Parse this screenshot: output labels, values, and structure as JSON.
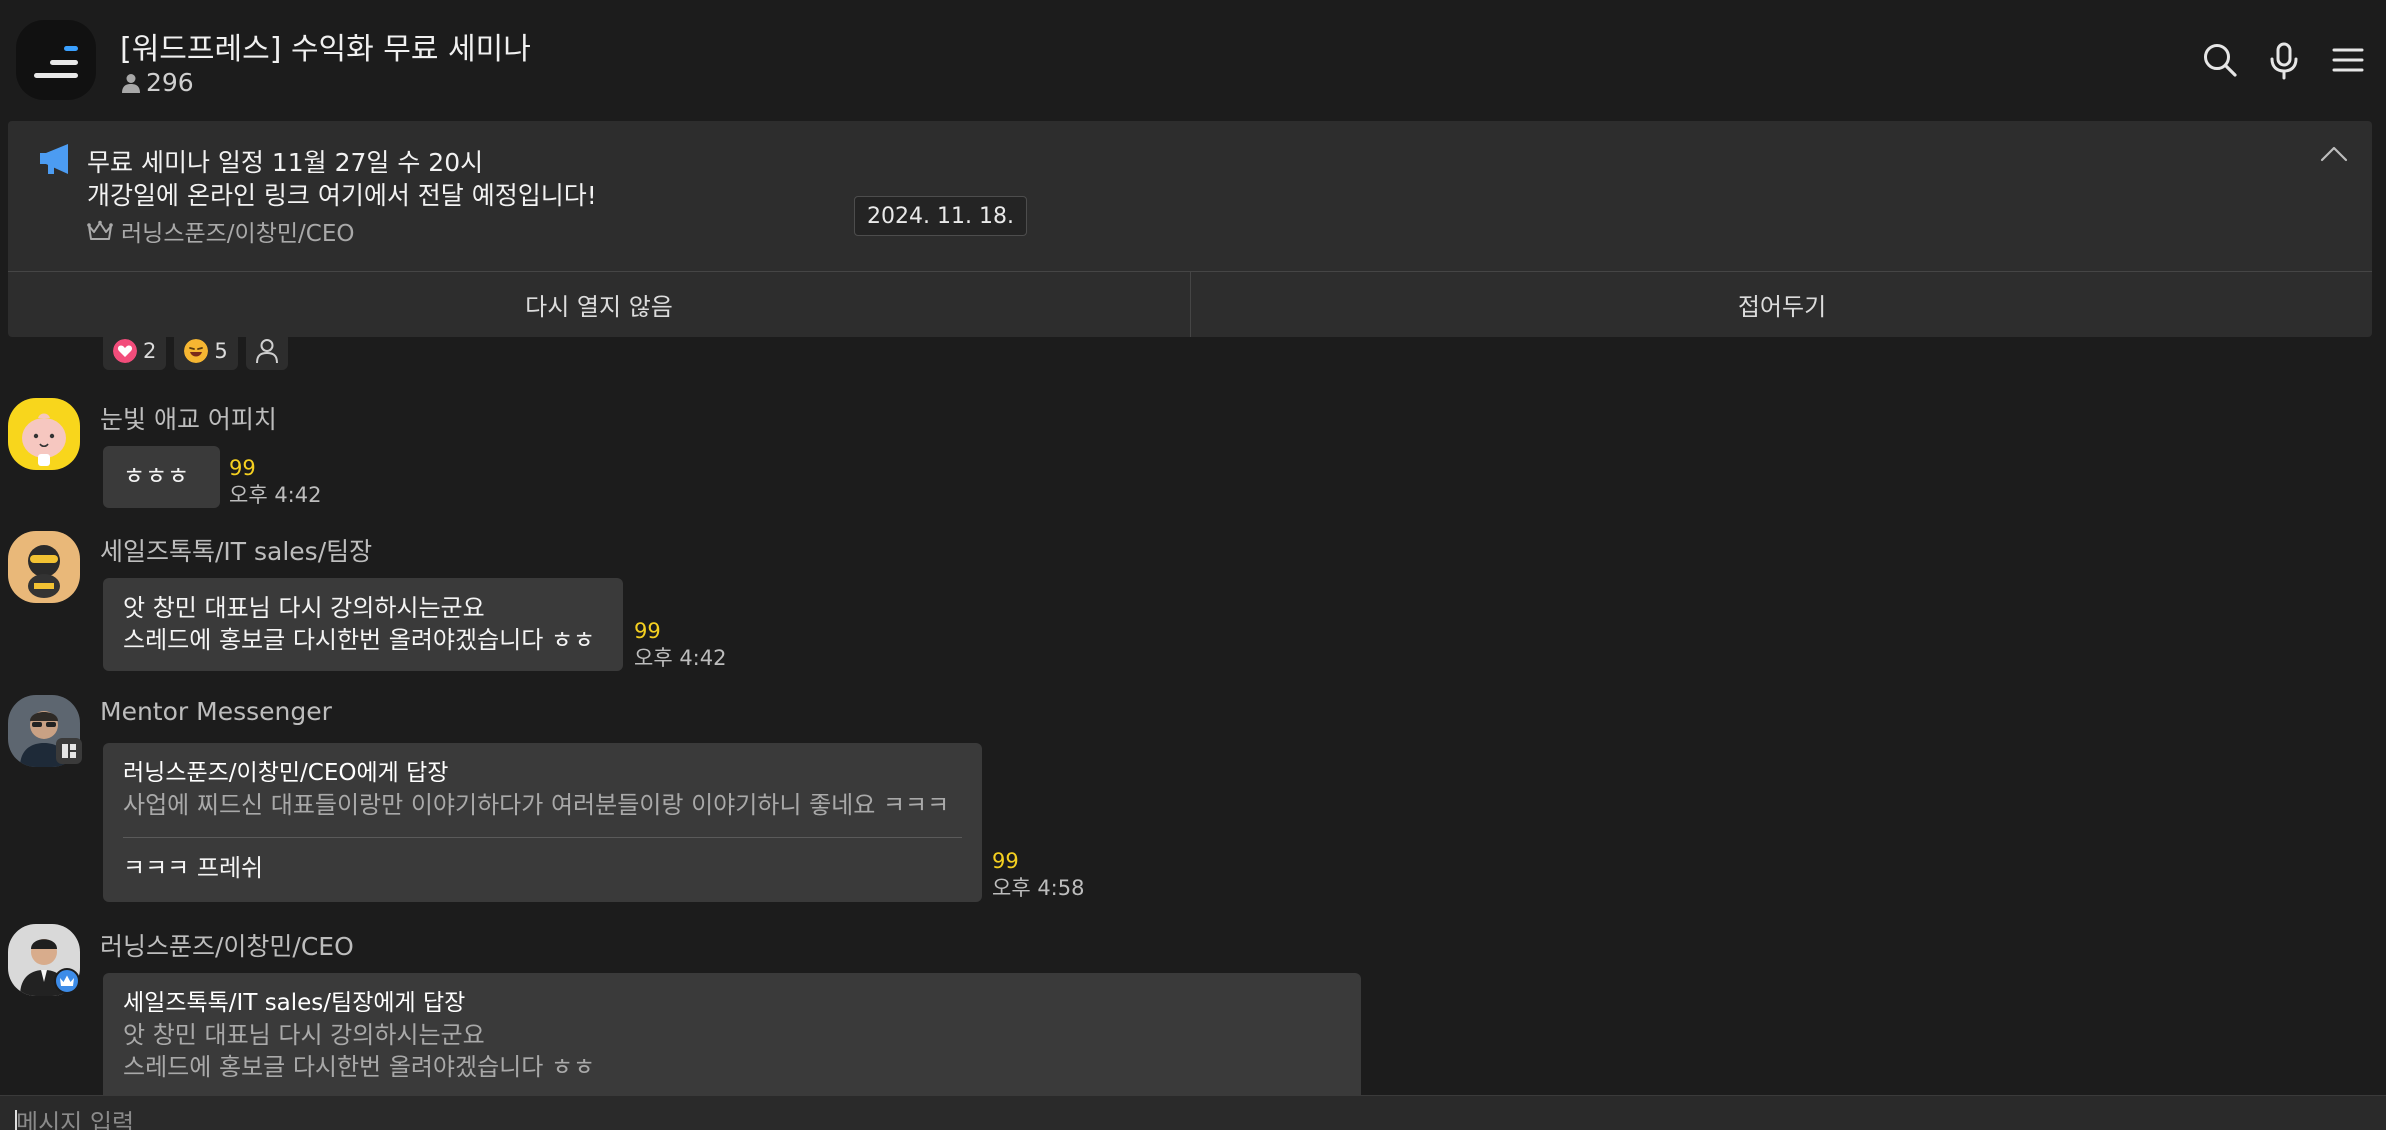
{
  "header": {
    "title": "[워드프레스] 수익화 무료 세미나",
    "member_count": "296",
    "icons": [
      "search-icon",
      "microphone-icon",
      "menu-icon"
    ]
  },
  "notice": {
    "line1": "무료 세미나 일정 11월 27일 수 20시",
    "line2": "개강일에 온라인 링크 여기에서 전달 예정입니다!",
    "author": "러닝스푼즈/이창민/CEO",
    "dont_show_again": "다시 열지 않음",
    "collapse": "접어두기"
  },
  "date_chip": "2024. 11. 18.",
  "reactions": [
    {
      "emoji": "heart-emoji",
      "count": "2"
    },
    {
      "emoji": "laughing-emoji",
      "count": "5"
    }
  ],
  "messages": [
    {
      "sender": "눈빛 애교 어피치",
      "text": "ㅎㅎㅎ",
      "unread": "99",
      "time": "오후 4:42"
    },
    {
      "sender": "세일즈톡톡/IT sales/팀장",
      "lines": [
        "앗 창민 대표님 다시 강의하시는군요",
        "스레드에 홍보글 다시한번 올려야겠습니다 ㅎㅎ"
      ],
      "unread": "99",
      "time": "오후 4:42"
    },
    {
      "sender": "Mentor Messenger",
      "reply_to": "러닝스푼즈/이창민/CEO에게 답장",
      "quote": "사업에 찌드신 대표들이랑만 이야기하다가 여러분들이랑 이야기하니 좋네요 ㅋㅋㅋ",
      "text": "ㅋㅋㅋ 프레쉬",
      "unread": "99",
      "time": "오후 4:58"
    },
    {
      "sender": "러닝스푼즈/이창민/CEO",
      "reply_to": "세일즈톡톡/IT sales/팀장에게 답장",
      "quote_lines": [
        "앗 창민 대표님 다시 강의하시는군요",
        "스레드에 홍보글 다시한번 올려야겠습니다 ㅎㅎ"
      ]
    }
  ],
  "input": {
    "placeholder": "메시지 입력",
    "value": ""
  },
  "colors": {
    "background": "#1c1c1c",
    "bubble": "#3a3a3a",
    "notice": "#2d2d2d",
    "unread": "#f5d020",
    "accent": "#3aa0ff"
  }
}
